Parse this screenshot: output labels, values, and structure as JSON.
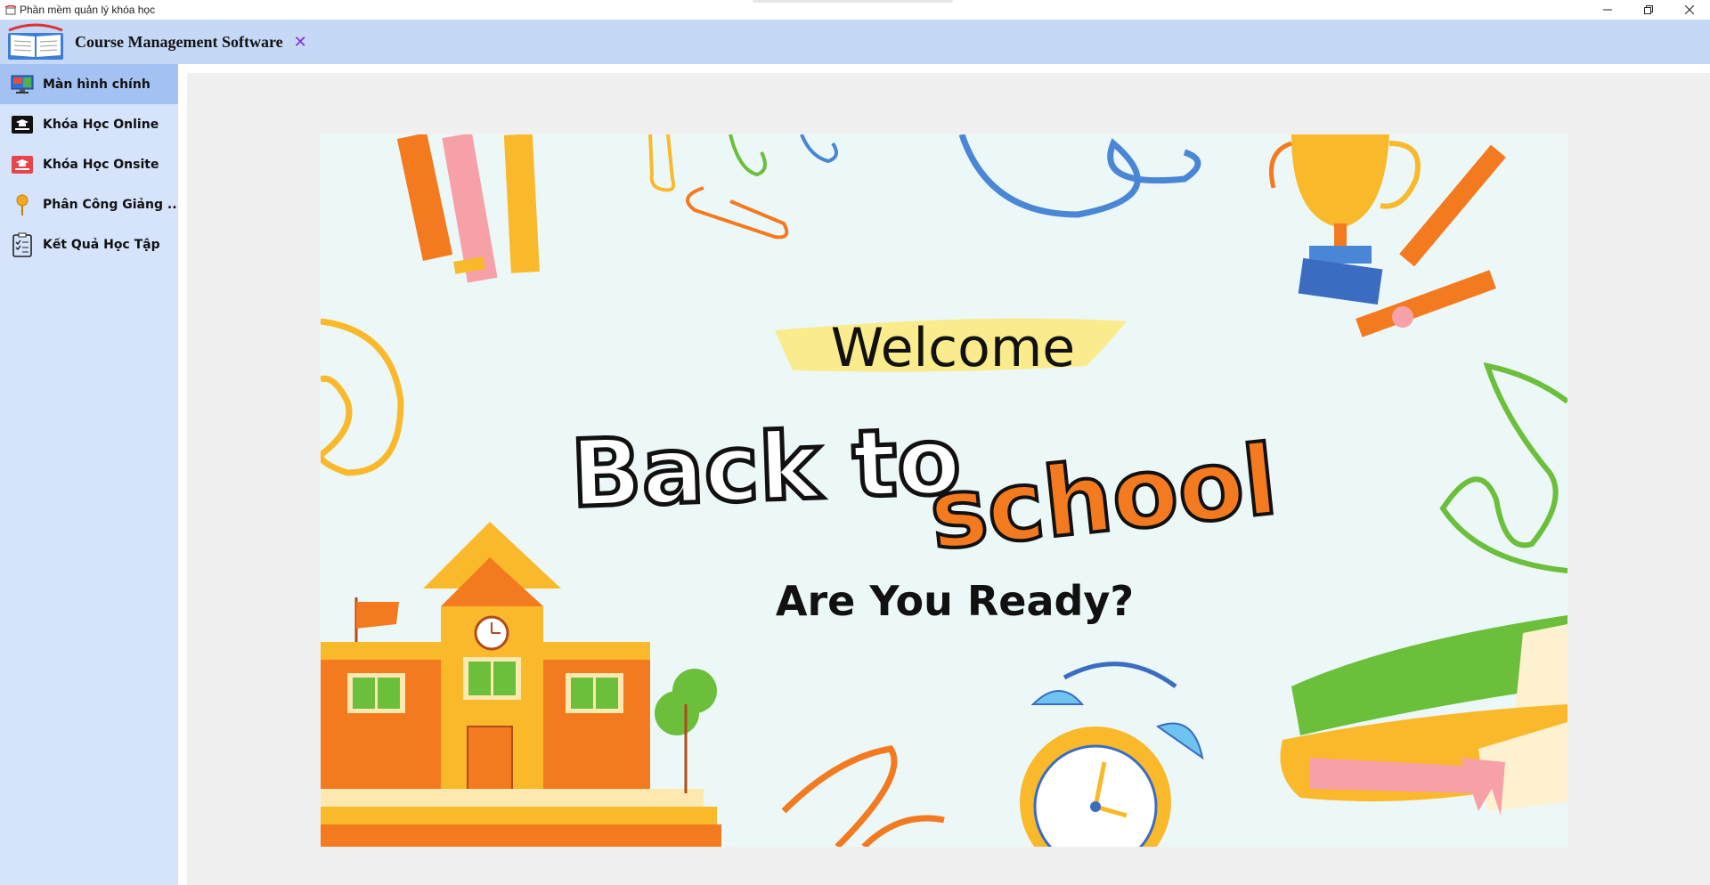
{
  "window": {
    "title": "Phần mềm quản lý khóa học",
    "buttons": {
      "minimize": "—",
      "maximize": "❐",
      "close": "✕"
    }
  },
  "header": {
    "app_name": "Course Management Software",
    "close_symbol": "✕",
    "accent_color": "#8a2be2"
  },
  "sidebar": {
    "items": [
      {
        "label": "Màn hình chính",
        "icon": "monitor-icon",
        "active": true
      },
      {
        "label": "Khóa Học Online",
        "icon": "graduation-online-icon",
        "active": false
      },
      {
        "label": "Khóa Học Onsite",
        "icon": "graduation-onsite-icon",
        "active": false
      },
      {
        "label": "Phân Công Giảng ...",
        "icon": "pushpin-icon",
        "active": false
      },
      {
        "label": "Kết Quả Học Tập",
        "icon": "clipboard-check-icon",
        "active": false
      }
    ]
  },
  "banner": {
    "welcome": "Welcome",
    "back_to": "Back to",
    "school": "school",
    "ready": "Are You Ready?"
  }
}
